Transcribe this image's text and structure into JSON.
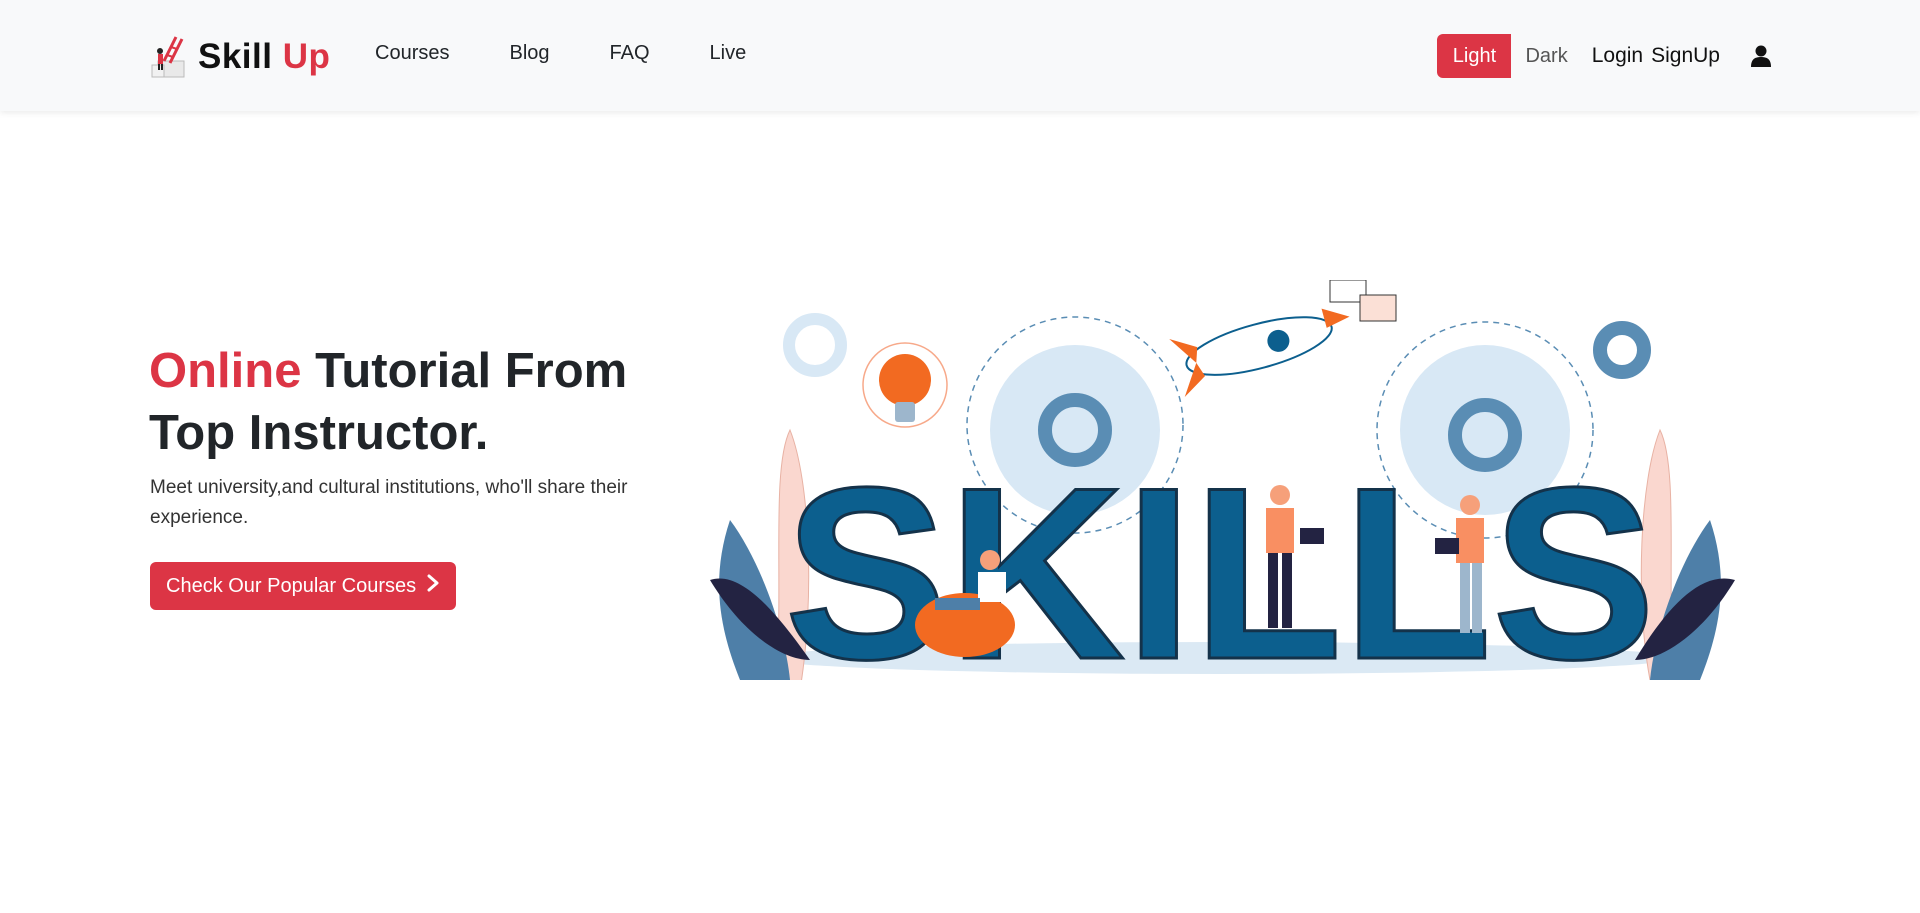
{
  "navbar": {
    "brand": {
      "name_part1": "Skill",
      "name_part2": "Up",
      "logo_icon": "ladder-person-icon"
    },
    "links": [
      {
        "label": "Courses"
      },
      {
        "label": "Blog"
      },
      {
        "label": "FAQ"
      },
      {
        "label": "Live"
      }
    ],
    "theme": {
      "light_label": "Light",
      "dark_label": "Dark"
    },
    "login_label": "Login",
    "signup_label": "SignUp",
    "user_icon": "user-icon"
  },
  "hero": {
    "title_accent": "Online",
    "title_rest": " Tutorial From Top Instructor.",
    "subtitle": "Meet university,and cultural institutions, who'll share their experience.",
    "cta_label": "Check Our Popular Courses",
    "cta_icon": "chevron-right-icon"
  },
  "illustration": {
    "word": "SKILLS"
  },
  "colors": {
    "accent": "#dc3545",
    "navbar_bg": "#f8f9fa",
    "skills_blue": "#0c5f8e",
    "gear_light": "#d8e8f5",
    "gear_mid": "#5a8db4",
    "orange": "#f26a21"
  }
}
